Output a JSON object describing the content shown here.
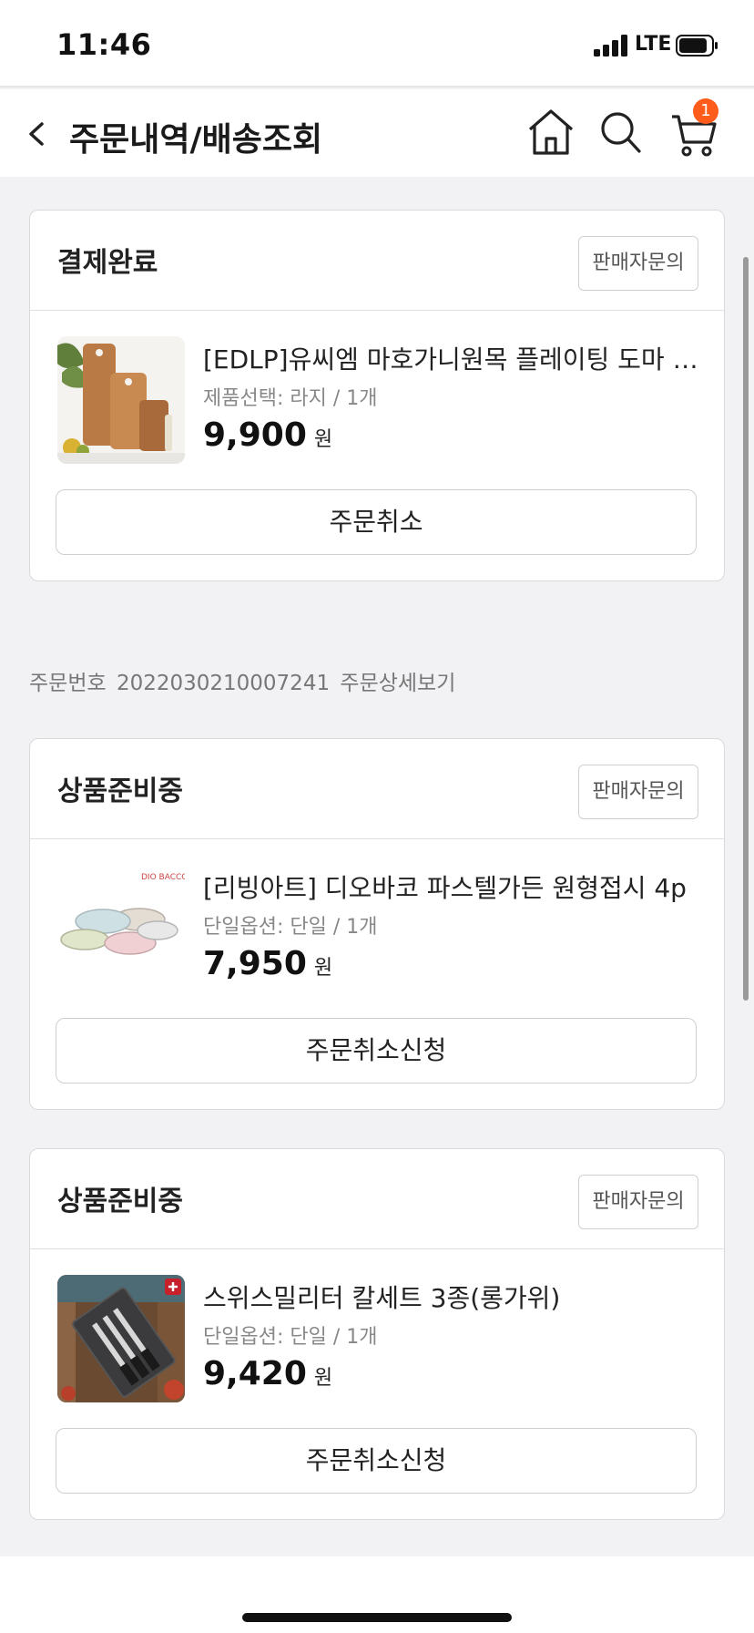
{
  "status_bar": {
    "time": "11:46",
    "network": "LTE"
  },
  "header": {
    "title": "주문내역/배송조회",
    "cart_count": "1"
  },
  "colors": {
    "accent": "#ff5b1a",
    "background": "#f2f2f4"
  },
  "orders": [
    {
      "status": "결제완료",
      "seller_button": "판매자문의",
      "product_name": "[EDLP]유씨엠 마호가니원목 플레이팅 도마 나...",
      "option": "제품선택: 라지 / 1개",
      "price": "9,900",
      "currency": "원",
      "action": "주문취소"
    },
    {
      "status": "상품준비중",
      "seller_button": "판매자문의",
      "product_name": "[리빙아트] 디오바코 파스텔가든 원형접시 4p",
      "option": "단일옵션: 단일 / 1개",
      "price": "7,950",
      "currency": "원",
      "action": "주문취소신청"
    },
    {
      "status": "상품준비중",
      "seller_button": "판매자문의",
      "product_name": "스위스밀리터 칼세트 3종(롱가위)",
      "option": "단일옵션: 단일 / 1개",
      "price": "9,420",
      "currency": "원",
      "action": "주문취소신청"
    }
  ],
  "order_info": {
    "label": "주문번호",
    "number": "2022030210007241",
    "detail_link": "주문상세보기"
  },
  "thumb_texts": {
    "plate_brand": "DIO BACCO"
  },
  "icons": {
    "back": "chevron-left-icon",
    "home": "home-icon",
    "search": "search-icon",
    "cart": "cart-icon"
  }
}
